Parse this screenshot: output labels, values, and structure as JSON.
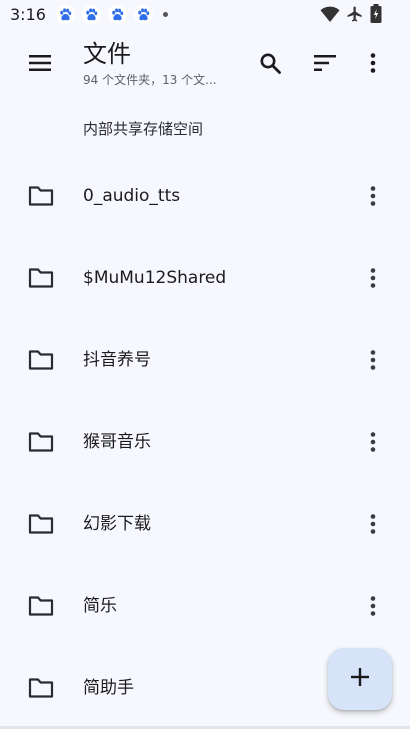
{
  "status_bar": {
    "time": "3:16",
    "notification_icons": [
      "baidu-paw-icon",
      "baidu-paw-icon",
      "baidu-paw-icon",
      "baidu-paw-icon"
    ],
    "right_icons": [
      "wifi-icon",
      "airplane-icon",
      "battery-icon"
    ]
  },
  "app_bar": {
    "title": "文件",
    "subtitle": "94 个文件夹，13 个文...",
    "icons": [
      "menu-icon",
      "search-icon",
      "sort-icon",
      "more-vert-icon"
    ]
  },
  "storage_label": "内部共享存储空间",
  "files": [
    {
      "name": "0_audio_tts",
      "icon": "folder-icon"
    },
    {
      "name": "$MuMu12Shared",
      "icon": "folder-icon"
    },
    {
      "name": "抖音养号",
      "icon": "folder-icon"
    },
    {
      "name": "猴哥音乐",
      "icon": "folder-icon"
    },
    {
      "name": "幻影下载",
      "icon": "folder-icon"
    },
    {
      "name": "简乐",
      "icon": "folder-icon"
    },
    {
      "name": "简助手",
      "icon": "folder-icon"
    }
  ],
  "fab": {
    "icon": "add-icon"
  },
  "colors": {
    "background": "#f7f8fd",
    "fab_background": "#d6e3f8",
    "notification_icon": "#2f6ee8",
    "text_primary": "#1b1b1f",
    "text_secondary": "#5f6068"
  }
}
